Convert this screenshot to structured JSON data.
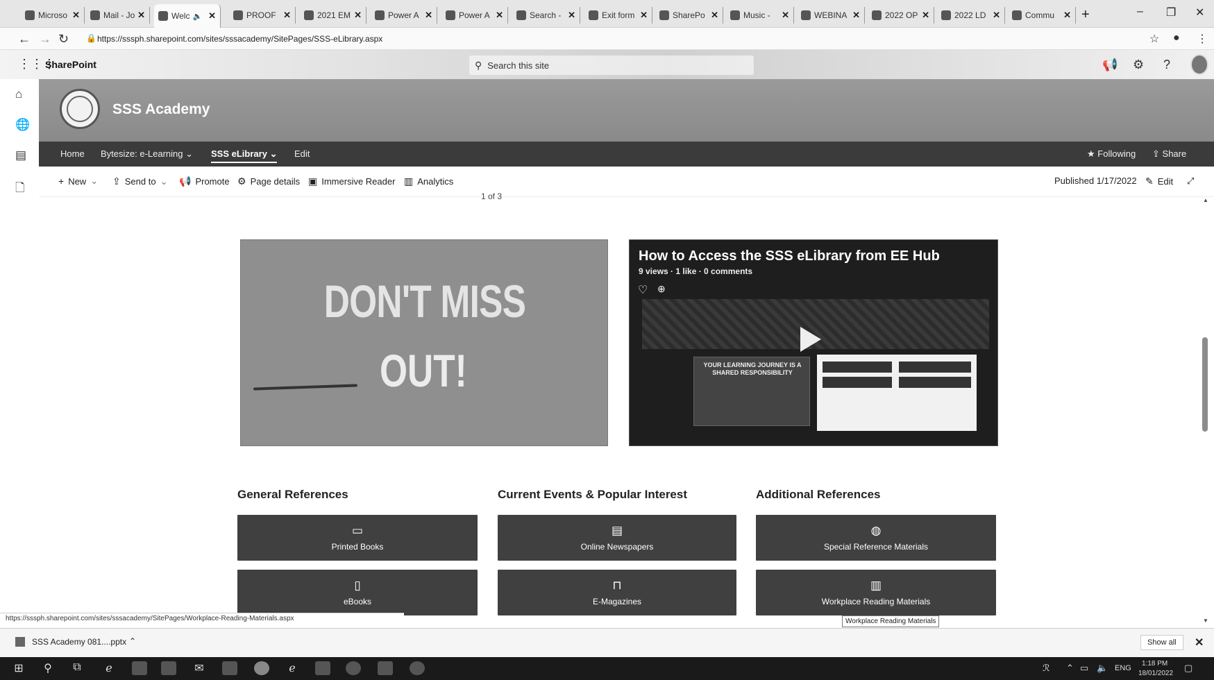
{
  "browser": {
    "tabs": [
      {
        "label": "Microso"
      },
      {
        "label": "Mail - Jo"
      },
      {
        "label": "Welc"
      },
      {
        "label": "PROOF"
      },
      {
        "label": "2021 EM"
      },
      {
        "label": "Power A"
      },
      {
        "label": "Power A"
      },
      {
        "label": "Search -"
      },
      {
        "label": "Exit form"
      },
      {
        "label": "SharePo"
      },
      {
        "label": "Music -"
      },
      {
        "label": "WEBINA"
      },
      {
        "label": "2022 OP"
      },
      {
        "label": "2022 LD"
      },
      {
        "label": "Commu"
      }
    ],
    "url": "https://sssph.sharepoint.com/sites/sssacademy/SitePages/SSS-eLibrary.aspx"
  },
  "suitebar": {
    "brand": "SharePoint",
    "search_placeholder": "Search this site"
  },
  "site": {
    "title": "SSS Academy",
    "logo_text": "SSS ACADEMY"
  },
  "nav": {
    "items": [
      {
        "label": "Home"
      },
      {
        "label": "Bytesize: e-Learning"
      },
      {
        "label": "SSS eLibrary"
      },
      {
        "label": "Edit"
      }
    ],
    "following": "Following",
    "share": "Share"
  },
  "commands": {
    "new": "New",
    "send_to": "Send to",
    "promote": "Promote",
    "page_details": "Page details",
    "immersive_reader": "Immersive Reader",
    "analytics": "Analytics",
    "published": "Published 1/17/2022",
    "edit": "Edit"
  },
  "content": {
    "pager": "1 of 3",
    "banner_line1": "DON'T MISS",
    "banner_line2": "OUT!",
    "video": {
      "title": "How to Access the SSS eLibrary from EE Hub",
      "meta": "9 views · 1 like · 0 comments",
      "slide_text": "YOUR LEARNING JOURNEY IS A SHARED RESPONSIBILITY"
    },
    "sections": [
      {
        "title": "General References",
        "links": [
          {
            "label": "Printed Books",
            "icon": "book-icon"
          },
          {
            "label": "eBooks",
            "icon": "ebook-icon"
          }
        ]
      },
      {
        "title": "Current Events & Popular Interest",
        "links": [
          {
            "label": "Online Newspapers",
            "icon": "newspaper-icon"
          },
          {
            "label": "E-Magazines",
            "icon": "bag-icon"
          }
        ]
      },
      {
        "title": "Additional References",
        "links": [
          {
            "label": "Special Reference Materials",
            "icon": "globe-icon"
          },
          {
            "label": "Workplace Reading Materials",
            "icon": "open-book-icon"
          }
        ]
      }
    ],
    "tooltip": "Workplace Reading Materials",
    "status_url": "https://sssph.sharepoint.com/sites/sssacademy/SitePages/Workplace-Reading-Materials.aspx"
  },
  "download": {
    "file": "SSS Academy 081....pptx",
    "show_all": "Show all"
  },
  "taskbar": {
    "lang": "ENG",
    "time": "1:18 PM",
    "date": "18/01/2022"
  },
  "colors": {
    "nav_bg": "#3b3b3b",
    "tile_bg": "#404040",
    "header_bg": "#8f8f8f"
  }
}
